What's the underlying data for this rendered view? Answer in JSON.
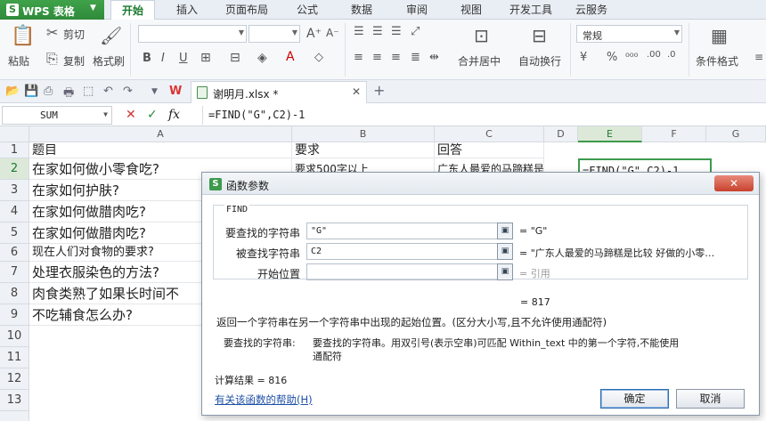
{
  "app": {
    "logo_text": "WPS 表格"
  },
  "menu": [
    "开始",
    "插入",
    "页面布局",
    "公式",
    "数据",
    "审阅",
    "视图",
    "开发工具",
    "云服务"
  ],
  "ribbon": {
    "paste": "粘贴",
    "cut": "剪切",
    "copy": "复制",
    "format_painter": "格式刷",
    "merge_center": "合并居中",
    "wrap_text": "自动换行",
    "number_format": "常规",
    "cond_format": "条件格式"
  },
  "doc_tab": {
    "name": "谢明月.xlsx *"
  },
  "formula_bar": {
    "name_box": "SUM",
    "formula": "=FIND(\"G\",C2)-1",
    "fx": "fx"
  },
  "grid": {
    "columns": [
      "A",
      "B",
      "C",
      "D",
      "E",
      "F",
      "G"
    ],
    "rows": [
      "1",
      "2",
      "3",
      "4",
      "5",
      "6",
      "7",
      "8",
      "9",
      "10",
      "11",
      "12",
      "13"
    ],
    "cells": {
      "A1": "题目",
      "B1": "要求",
      "C1": "回答",
      "A2": "在家如何做小零食吃?",
      "B2": "要求500字以上",
      "C2": "广东人最爱的马蹄糕是比",
      "E2": "=FIND(\"G\",C2)-1",
      "A3": "在家如何护肤?",
      "A4": "在家如何做腊肉吃?",
      "A5": "在家如何做腊肉吃?",
      "A6": "现在人们对食物的要求?",
      "A7": "处理衣服染色的方法?",
      "A8": "肉食类熟了如果长时间不",
      "A9": "不吃辅食怎么办?"
    }
  },
  "dialog": {
    "title": "函数参数",
    "close": "✕",
    "function_name": "FIND",
    "args": [
      {
        "label": "要查找的字符串",
        "value": "\"G\"",
        "result": "= \"G\""
      },
      {
        "label": "被查找字符串",
        "value": "C2",
        "result": "= \"广东人最爱的马蹄糕是比较 好做的小零…"
      },
      {
        "label": "开始位置",
        "value": "",
        "result": "= 引用"
      }
    ],
    "inner_result": "= 817",
    "description": "返回一个字符串在另一个字符串中出现的起始位置。(区分大小写,且不允许使用通配符)",
    "param_name": "要查找的字符串:",
    "param_desc_1": "要查找的字符串。用双引号(表示空串)可匹配 Within_text 中的第一个字符,不能使用",
    "param_desc_2": "通配符",
    "calc_result": "计算结果 = 816",
    "help_link": "有关该函数的帮助(H)",
    "ok": "确定",
    "cancel": "取消"
  }
}
